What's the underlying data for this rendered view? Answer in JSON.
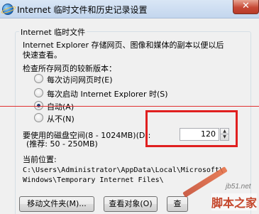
{
  "window": {
    "title": "Internet 临时文件和历史记录设置",
    "close_label": "✕",
    "icon": "internet-explorer-icon"
  },
  "temp_files": {
    "group_label": "Internet 临时文件",
    "description_line1": "Internet Explorer 存储网页、图像和媒体的副本以便以后",
    "description_line2": "快速查看。",
    "check_prompt": "检查所存网页的较新版本：",
    "options": [
      "每次访问网页时(E)",
      "每次启动 Internet Explorer 时(S)",
      "自动(A)",
      "从不(N)"
    ],
    "selected_index": 2,
    "disk_space_label": "要使用的磁盘空间(8 - 1024MB)(D):",
    "disk_space_hint": "(推荐: 50 - 250MB)",
    "disk_space_value": "120",
    "current_location_label": "当前位置:",
    "path_line1": "C:\\Users\\Administrator\\AppData\\Local\\Microsoft\\",
    "path_line2": "Windows\\Temporary Internet Files\\",
    "move_folder_button": "移动文件夹(M)...",
    "view_objects_button": "查看对象(O)",
    "view_files_button": "查"
  },
  "watermark": {
    "url": "jb51.net",
    "name": "脚本之家"
  },
  "colors": {
    "annotation_red": "#e02020",
    "title_bar": "#c3d6ee"
  }
}
